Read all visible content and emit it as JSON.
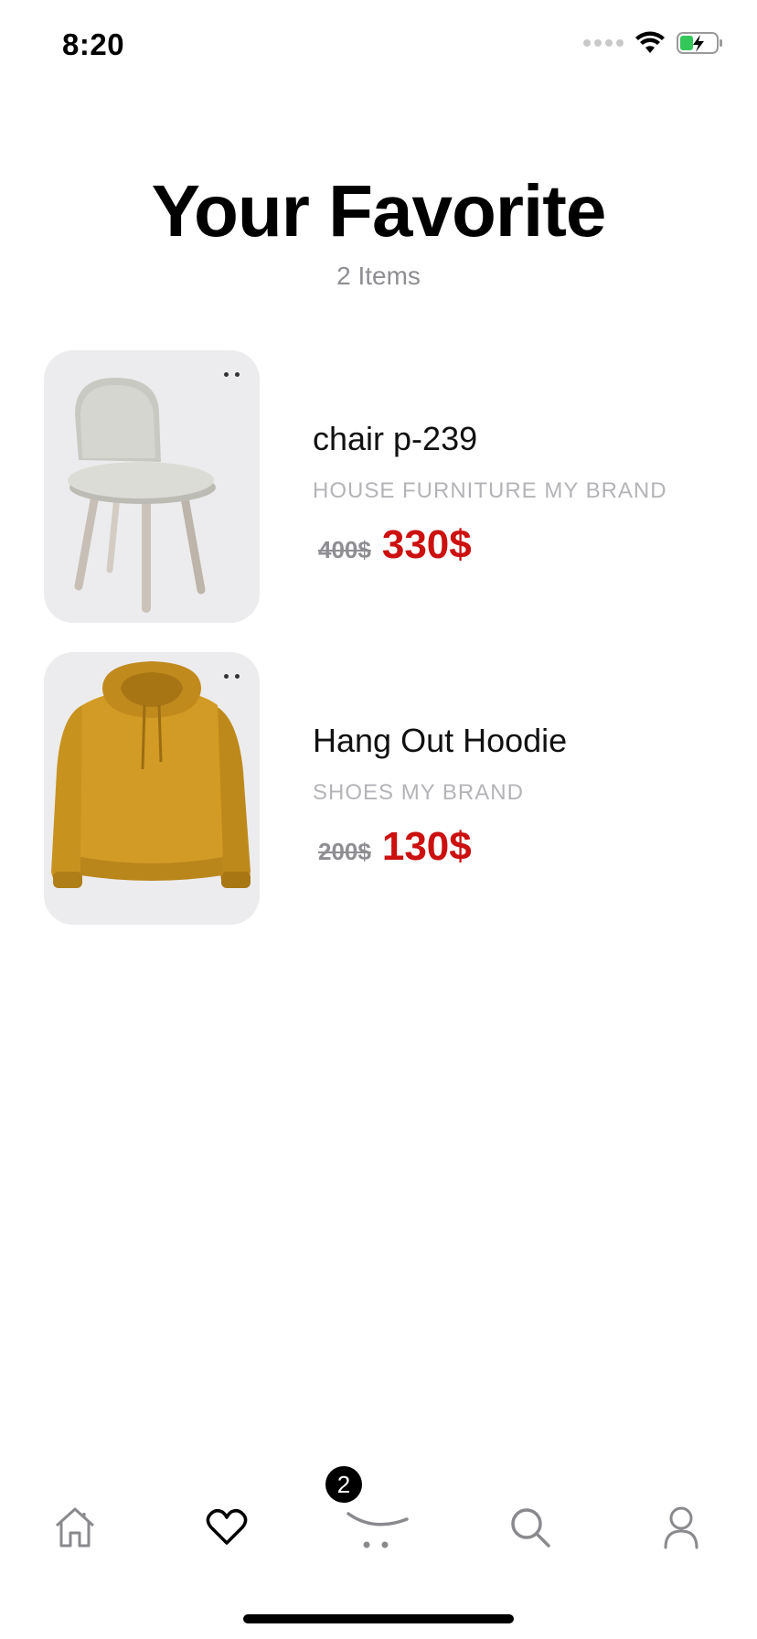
{
  "status_bar": {
    "time": "8:20"
  },
  "header": {
    "title": "Your Favorite",
    "count_label": "2 Items"
  },
  "favorites": [
    {
      "name": "chair p-239",
      "category": "HOUSE FURNITURE MY BRAND",
      "old_price": "400$",
      "new_price": "330$",
      "image_icon": "chair-image"
    },
    {
      "name": "Hang Out Hoodie",
      "category": "SHOES MY BRAND",
      "old_price": "200$",
      "new_price": "130$",
      "image_icon": "hoodie-image"
    }
  ],
  "tab_bar": {
    "cart_badge": "2",
    "tabs": [
      "home-icon",
      "heart-icon",
      "cart-icon",
      "search-icon",
      "user-icon"
    ]
  },
  "colors": {
    "accent_price": "#cc1010",
    "muted_text": "#8e8e93",
    "thumb_bg": "#ececee"
  }
}
